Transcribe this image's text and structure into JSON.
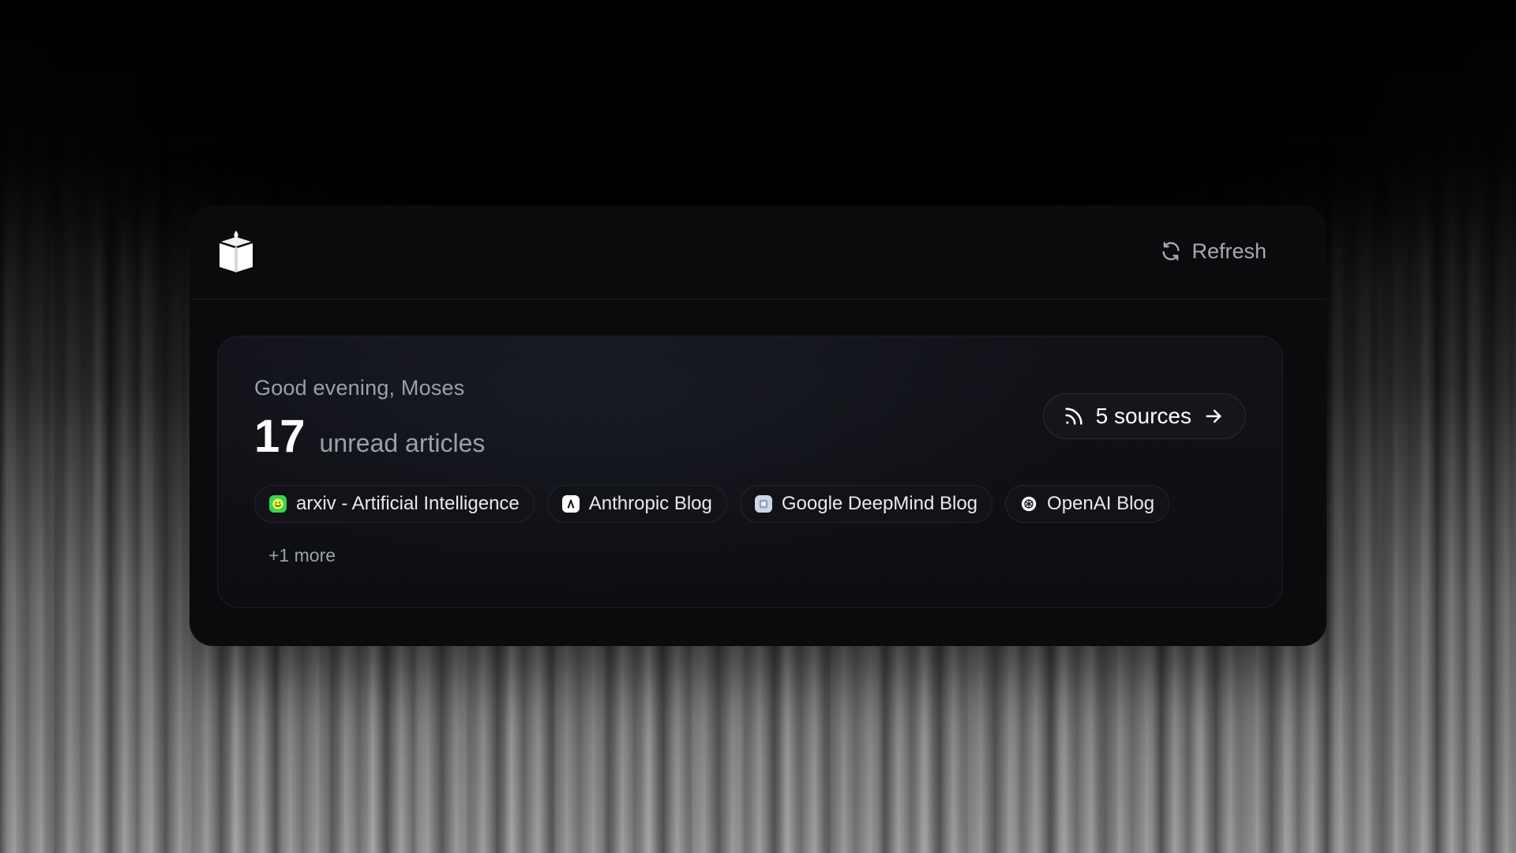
{
  "header": {
    "logo_icon": "open-book-icon",
    "refresh_label": "Refresh",
    "refresh_icon": "refresh-icon"
  },
  "hero": {
    "greeting": "Good evening, Moses",
    "unread_count": "17",
    "unread_label": "unread articles",
    "sources_label": "5 sources",
    "sources_icon": "rss-icon",
    "sources_arrow_icon": "arrow-right-icon"
  },
  "feeds": [
    {
      "label": "arxiv - Artificial Intelligence",
      "icon": "arxiv-icon",
      "color": "#39d353"
    },
    {
      "label": "Anthropic Blog",
      "icon": "anthropic-icon",
      "color": "#ffffff"
    },
    {
      "label": "Google DeepMind Blog",
      "icon": "deepmind-icon",
      "color": "#cfd6e6"
    },
    {
      "label": "OpenAI Blog",
      "icon": "openai-icon",
      "color": "#ffffff"
    }
  ],
  "more_label": "+1 more",
  "colors": {
    "card_bg": "#0b0b0d",
    "text_primary": "#ffffff",
    "text_muted": "#9aa0aa"
  }
}
